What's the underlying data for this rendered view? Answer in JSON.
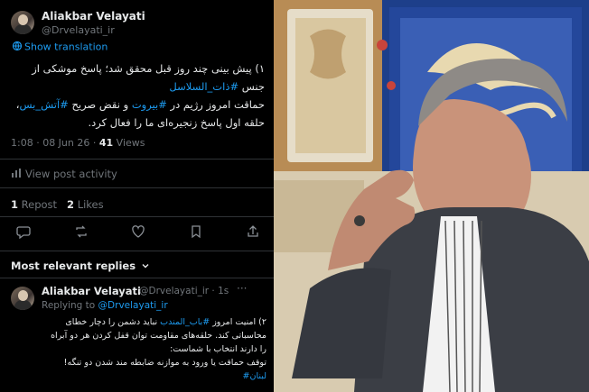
{
  "post": {
    "author": "Aliakbar Velayati",
    "handle": "@Drvelayati_ir",
    "show_translation": "Show translation",
    "line1": "۱) پیش بینی چند روز قبل محقق شد؛ پاسخ موشکی از",
    "line2_prefix": "جنس ",
    "line2_tag": "#ذات_السلاسل",
    "line3_prefix": "حماقت امروز رژیم در ",
    "line3_tag": "#بیروت",
    "line3_suffix": " و نقض صریح ",
    "line3_tag2": "#آتش_بس",
    "line3_end": "،",
    "line4": "حلقه اول پاسخ زنجیره‌ای ما را فعال کرد.",
    "time": "1:08 · 08 Jun 26 · ",
    "views_count": "41",
    "views_label": " Views",
    "view_activity": "View post activity",
    "reposts_count": "1",
    "reposts_label": " Repost",
    "likes_count": "2",
    "likes_label": " Likes"
  },
  "actions": [
    "reply-icon",
    "repost-icon",
    "like-icon",
    "bookmark-icon",
    "share-icon"
  ],
  "replies_header": "Most relevant replies",
  "reply": {
    "author": "Aliakbar Velayati",
    "handle": "@Drvelayati_ir · 1s",
    "replying_prefix": "Replying to ",
    "replying_handle": "@Drvelayati_ir",
    "line1_prefix": "۲) امنیت امروز ",
    "line1_tag": "#باب_المندب",
    "line1_suffix": " نباید دشمن را دچار خطای",
    "line2": "محاسباتی کند. حلقه‌های مقاومت توان قفل کردن هر دو آبراه",
    "line3": "را دارند انتخاب با شماست:",
    "line4": "توقف حماقت یا ورود به موازنه ضابطه مند شدن دو تنگه!",
    "line5_tag": "لبنان#"
  },
  "colors": {
    "accent": "#1d9bf0",
    "text": "#e7e9ea",
    "muted": "#71767b",
    "bg": "#000000"
  }
}
